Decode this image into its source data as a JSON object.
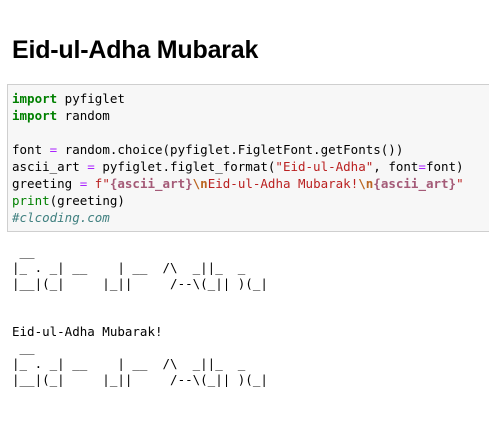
{
  "heading": "Eid-ul-Adha Mubarak",
  "code_lines": [
    [
      {
        "t": "import",
        "c": "kw"
      },
      {
        "t": " pyfiglet",
        "c": ""
      }
    ],
    [
      {
        "t": "import",
        "c": "kw"
      },
      {
        "t": " random",
        "c": ""
      }
    ],
    [],
    [
      {
        "t": "font ",
        "c": ""
      },
      {
        "t": "=",
        "c": "op"
      },
      {
        "t": " random.choice(pyfiglet.FigletFont.getFonts())",
        "c": ""
      }
    ],
    [
      {
        "t": "ascii_art ",
        "c": ""
      },
      {
        "t": "=",
        "c": "op"
      },
      {
        "t": " pyfiglet.figlet_format(",
        "c": ""
      },
      {
        "t": "\"Eid-ul-Adha\"",
        "c": "str"
      },
      {
        "t": ", font",
        "c": ""
      },
      {
        "t": "=",
        "c": "op"
      },
      {
        "t": "font)",
        "c": ""
      }
    ],
    [
      {
        "t": "greeting ",
        "c": ""
      },
      {
        "t": "=",
        "c": "op"
      },
      {
        "t": " ",
        "c": ""
      },
      {
        "t": "f\"",
        "c": "str"
      },
      {
        "t": "{ascii_art}",
        "c": "interp"
      },
      {
        "t": "\\n",
        "c": "esc"
      },
      {
        "t": "Eid-ul-Adha Mubarak!",
        "c": "str"
      },
      {
        "t": "\\n",
        "c": "esc"
      },
      {
        "t": "{ascii_art}",
        "c": "interp"
      },
      {
        "t": "\"",
        "c": "str"
      }
    ],
    [
      {
        "t": "print",
        "c": "bi"
      },
      {
        "t": "(greeting)",
        "c": ""
      }
    ],
    [
      {
        "t": "#clcoding.com",
        "c": "cm"
      }
    ]
  ],
  "output_text": " __\n|_ . _| __    | __  /\\  _||_  _\n|__|(_|     |_||     /--\\(_|| )(_|\n\n\nEid-ul-Adha Mubarak!\n __\n|_ . _| __    | __  /\\  _||_  _\n|__|(_|     |_||     /--\\(_|| )(_|"
}
